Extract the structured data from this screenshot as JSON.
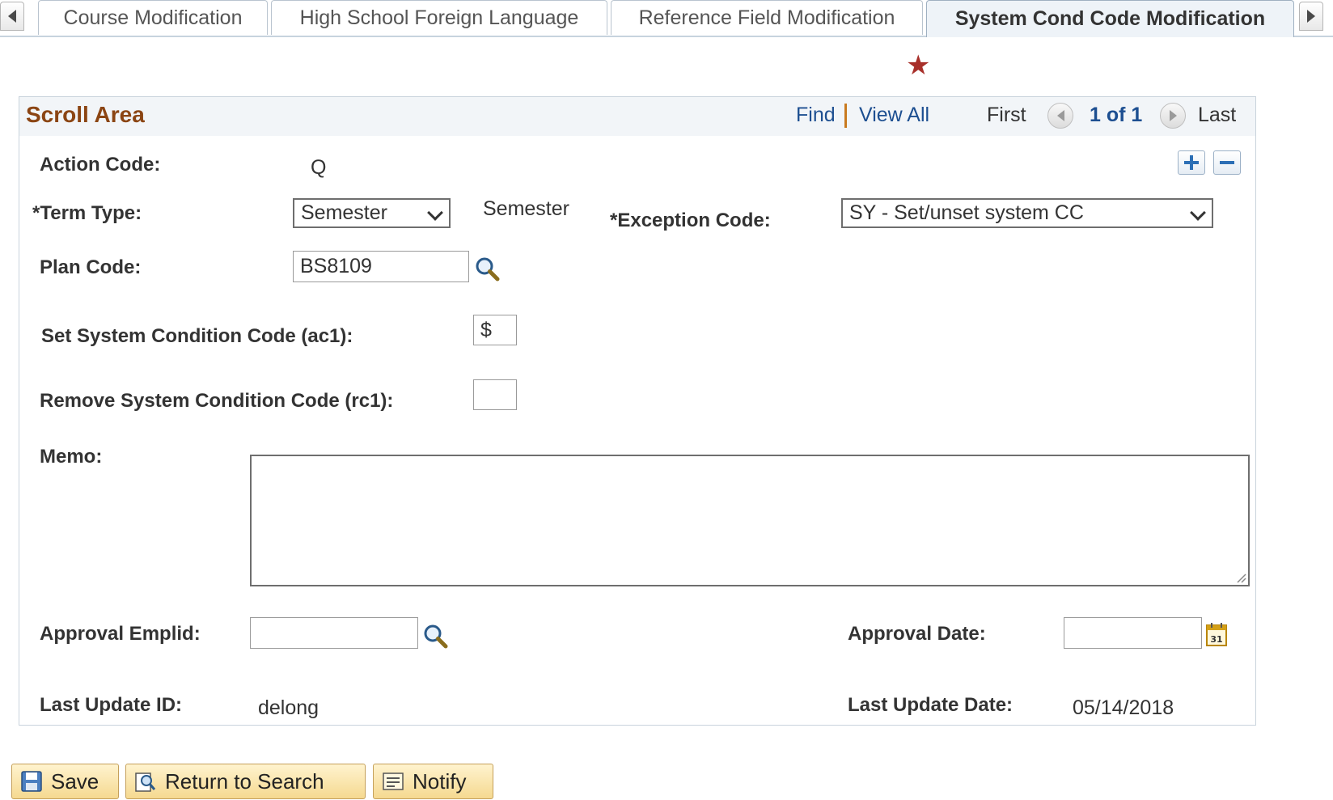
{
  "tabs": [
    {
      "label": "Course Modification",
      "active": false
    },
    {
      "label": "High School Foreign Language",
      "active": false
    },
    {
      "label": "Reference Field Modification",
      "active": false
    },
    {
      "label": "System Cond Code Modification",
      "active": true
    }
  ],
  "scroll_area": {
    "title": "Scroll Area",
    "find": "Find",
    "view_all": "View All",
    "first": "First",
    "pager": "1 of 1",
    "last": "Last"
  },
  "form": {
    "action_code_label": "Action Code:",
    "action_code_value": "Q",
    "term_type_label": "*Term Type:",
    "term_type_value": "Semester",
    "term_type_desc": "Semester",
    "exception_code_label": "*Exception Code:",
    "exception_code_value": "SY - Set/unset system CC",
    "plan_code_label": "Plan Code:",
    "plan_code_value": "BS8109",
    "set_cc_label": "Set System Condition Code (ac1):",
    "set_cc_value": "$",
    "remove_cc_label": "Remove System Condition Code (rc1):",
    "remove_cc_value": "",
    "memo_label": "Memo:",
    "memo_value": "",
    "approval_emplid_label": "Approval Emplid:",
    "approval_emplid_value": "",
    "approval_date_label": "Approval Date:",
    "approval_date_value": "",
    "last_update_id_label": "Last Update ID:",
    "last_update_id_value": "delong",
    "last_update_date_label": "Last Update Date:",
    "last_update_date_value": "05/14/2018"
  },
  "buttons": {
    "save": "Save",
    "return_to_search": "Return to Search",
    "notify": "Notify"
  },
  "colors": {
    "title_brown": "#8b4513",
    "link_blue": "#1d4f91",
    "star_red": "#a8302a",
    "button_gold": "#f5d990"
  }
}
